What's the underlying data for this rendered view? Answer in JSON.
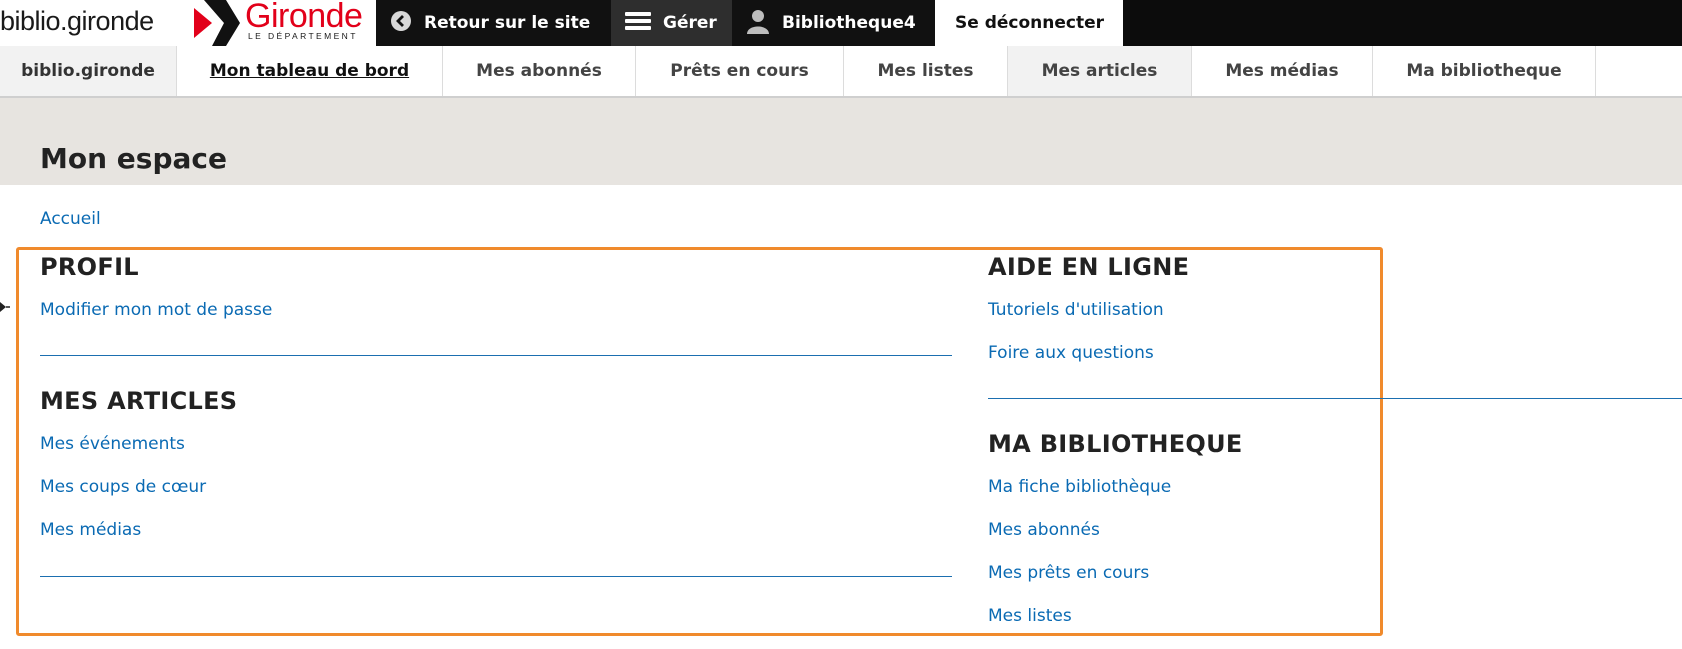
{
  "header": {
    "brand": "biblio.gironde",
    "logo_main": "Gironde",
    "logo_sub": "LE DÉPARTEMENT",
    "retour_label": "Retour sur le site",
    "gerer_label": "Gérer",
    "user_label": "Bibliotheque4",
    "logout_label": "Se déconnecter"
  },
  "nav": {
    "items": [
      {
        "label": "biblio.gironde"
      },
      {
        "label": "Mon tableau de bord"
      },
      {
        "label": "Mes abonnés"
      },
      {
        "label": "Prêts en cours"
      },
      {
        "label": "Mes listes"
      },
      {
        "label": "Mes articles"
      },
      {
        "label": "Mes médias"
      },
      {
        "label": "Ma bibliotheque"
      }
    ]
  },
  "page": {
    "title": "Mon espace",
    "breadcrumb": "Accueil"
  },
  "sections": {
    "profil": {
      "title": "PROFIL",
      "links": [
        "Modifier mon mot de passe"
      ]
    },
    "articles": {
      "title": "MES ARTICLES",
      "links": [
        "Mes événements",
        "Mes coups de cœur",
        "Mes médias"
      ]
    },
    "aide": {
      "title": "AIDE EN LIGNE",
      "links": [
        "Tutoriels d'utilisation",
        "Foire aux questions"
      ]
    },
    "bibliotheque": {
      "title": "MA BIBLIOTHEQUE",
      "links": [
        "Ma fiche bibliothèque",
        "Mes abonnés",
        "Mes prêts en cours",
        "Mes listes"
      ]
    }
  },
  "colors": {
    "link": "#0a6ab3",
    "highlight_border": "#f08a2c",
    "logo_red": "#e2001a",
    "header_band": "#e7e4e0"
  }
}
